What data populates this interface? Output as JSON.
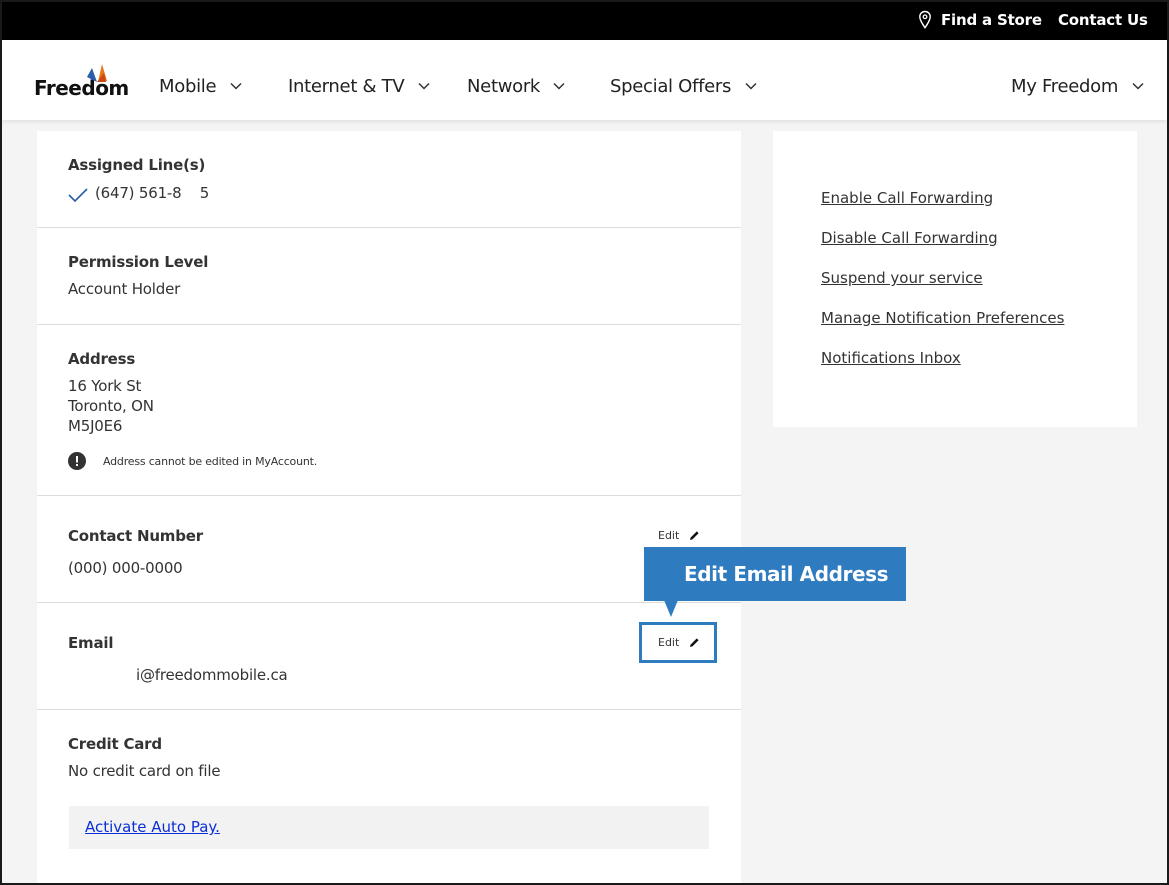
{
  "topbar": {
    "find_store": "Find a Store",
    "contact_us": "Contact Us",
    "pin_icon": "map-pin-icon"
  },
  "header": {
    "logo_text": "Freedom",
    "nav": [
      {
        "label": "Mobile"
      },
      {
        "label": "Internet & TV"
      },
      {
        "label": "Network"
      },
      {
        "label": "Special Offers"
      }
    ],
    "account_menu": "My Freedom"
  },
  "profile": {
    "assigned_lines": {
      "label": "Assigned Line(s)",
      "value": "(647) 561-8    5"
    },
    "permission": {
      "label": "Permission Level",
      "value": "Account Holder"
    },
    "address": {
      "label": "Address",
      "line1": "16 York St",
      "line2": "Toronto, ON",
      "line3": "M5J0E6",
      "notice": "Address cannot be edited in MyAccount."
    },
    "contact_number": {
      "label": "Contact Number",
      "value": "(000) 000-0000",
      "edit": "Edit"
    },
    "email": {
      "label": "Email",
      "value": "i@freedommobile.ca",
      "edit": "Edit"
    },
    "credit_card": {
      "label": "Credit Card",
      "value": "No credit card on file",
      "autopay": "Activate Auto Pay."
    }
  },
  "side_links": {
    "enable_forwarding": "Enable Call Forwarding",
    "disable_forwarding": "Disable Call Forwarding",
    "suspend": "Suspend your service",
    "notif_prefs": "Manage Notification Preferences",
    "notif_inbox": "Notifications Inbox"
  },
  "annotation": {
    "callout": "Edit Email Address"
  },
  "colors": {
    "accent": "#2e7bc0",
    "topbar": "#000000",
    "link": "#0b2fd6",
    "logo_orange": "#e8751a",
    "logo_blue": "#2a5caa"
  }
}
